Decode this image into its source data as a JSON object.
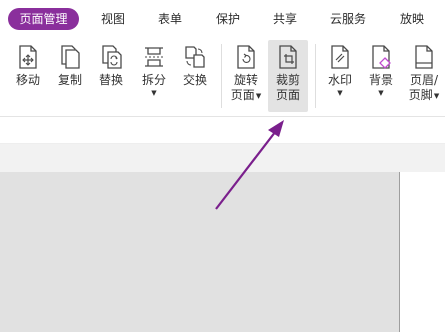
{
  "tabs": [
    {
      "label": "页面管理",
      "active": true
    },
    {
      "label": "视图"
    },
    {
      "label": "表单"
    },
    {
      "label": "保护"
    },
    {
      "label": "共享"
    },
    {
      "label": "云服务"
    },
    {
      "label": "放映"
    }
  ],
  "ribbon": {
    "move": {
      "label": "移动"
    },
    "copy": {
      "label": "复制"
    },
    "replace": {
      "label": "替换"
    },
    "split": {
      "label": "拆分",
      "has_dropdown": true
    },
    "swap": {
      "label": "交换"
    },
    "rotate": {
      "label_line1": "旋转",
      "label_line2": "页面",
      "has_dropdown": true
    },
    "crop": {
      "label_line1": "裁剪",
      "label_line2": "页面",
      "highlighted": true
    },
    "watermark": {
      "label": "水印",
      "has_dropdown": true
    },
    "background": {
      "label": "背景",
      "has_dropdown": true
    },
    "header_footer": {
      "label_line1": "页眉/",
      "label_line2": "页脚",
      "has_dropdown": true
    }
  },
  "colors": {
    "accent": "#8a2f9c",
    "arrow": "#7a1f8c",
    "canvas": "#e1e1e1"
  }
}
